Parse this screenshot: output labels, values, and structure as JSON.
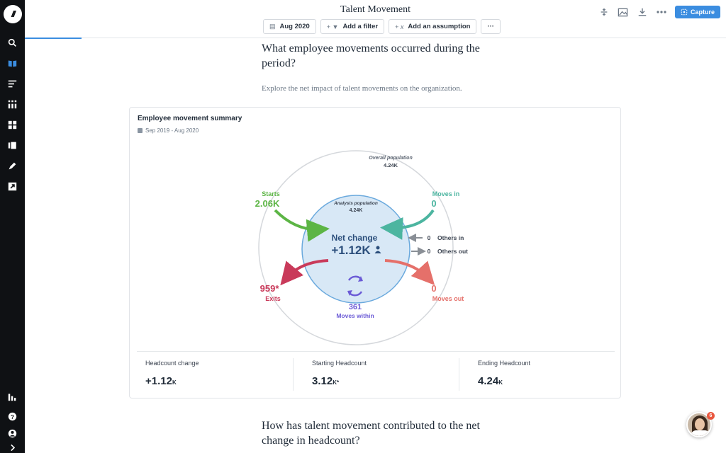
{
  "header": {
    "title": "Talent Movement",
    "chips": [
      {
        "icon": "calendar-icon",
        "label": "Aug 2020"
      },
      {
        "icon": "filter-icon",
        "label": "Add a filter"
      },
      {
        "icon": "variable-icon",
        "label": "Add an assumption"
      },
      {
        "icon": "more-icon",
        "label": "···"
      }
    ],
    "capture_label": "Capture"
  },
  "content": {
    "question1": "What employee movements occurred during the period?",
    "subtitle": "Explore the net impact of talent movements on the organization.",
    "question2": "How has talent movement contributed to the net change in headcount?"
  },
  "card": {
    "title": "Employee movement summary",
    "date_range": "Sep 2019 - Aug 2020",
    "overall_label": "Overall population",
    "overall_value": "4.24K",
    "analysis_label": "Analysis population",
    "analysis_value": "4.24K",
    "net_label": "Net change",
    "net_value": "+1.12K",
    "starts_label": "Starts",
    "starts_value": "2.06K",
    "moves_in_label": "Moves in",
    "moves_in_value": "0",
    "others_in_value": "0",
    "others_in_label": "Others in",
    "others_out_value": "0",
    "others_out_label": "Others out",
    "exits_value": "959*",
    "exits_label": "Exits",
    "moves_out_value": "0",
    "moves_out_label": "Moves out",
    "moves_within_value": "361",
    "moves_within_label": "Moves within",
    "stats": [
      {
        "label": "Headcount change",
        "value": "+1.12",
        "unit": "K"
      },
      {
        "label": "Starting Headcount",
        "value": "3.12",
        "unit": "K*"
      },
      {
        "label": "Ending Headcount",
        "value": "4.24",
        "unit": "K"
      }
    ]
  },
  "chat": {
    "badge": "6"
  },
  "colors": {
    "starts": "#5cb545",
    "moves_in": "#4cb5a0",
    "exits": "#c93a5a",
    "moves_out": "#e5706a",
    "moves_within": "#6b5bd6",
    "net": "#2c4f7c",
    "others": "#8a8f96",
    "accent": "#3b8de0"
  }
}
